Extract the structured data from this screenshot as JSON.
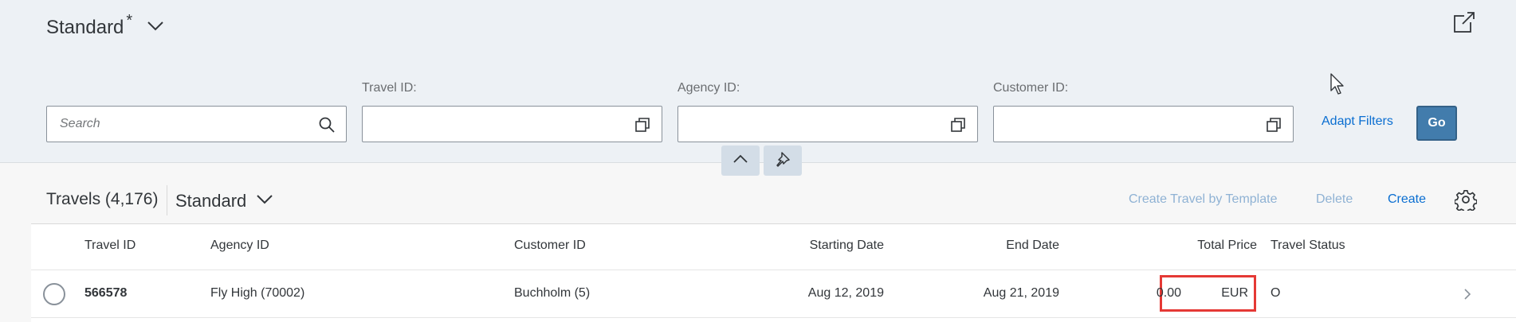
{
  "header": {
    "variant_title": "Standard",
    "variant_modified": "*"
  },
  "filters": {
    "search_placeholder": "Search",
    "travel_id_label": "Travel ID:",
    "agency_id_label": "Agency ID:",
    "customer_id_label": "Customer ID:",
    "adapt_filters_label": "Adapt Filters",
    "go_label": "Go"
  },
  "table": {
    "title": "Travels (4,176)",
    "variant": "Standard",
    "actions": {
      "create_by_template": "Create Travel by Template",
      "delete": "Delete",
      "create": "Create"
    },
    "columns": [
      "Travel ID",
      "Agency ID",
      "Customer ID",
      "Starting Date",
      "End Date",
      "Total Price",
      "Travel Status"
    ],
    "rows": [
      {
        "travel_id": "566578",
        "agency": "Fly High (70002)",
        "customer": "Buchholm (5)",
        "start": "Aug 12, 2019",
        "end": "Aug 21, 2019",
        "price": "0.00",
        "currency": "EUR",
        "status": "O"
      }
    ]
  },
  "colors": {
    "accent": "#0a6ed1",
    "go_button": "#427cac",
    "highlight": "#e53935",
    "disabled_action": "#8fb2d4"
  },
  "icons": [
    "chevron-down-icon",
    "share-icon",
    "search-icon",
    "value-help-icon",
    "collapse-header-icon",
    "pin-icon",
    "settings-icon",
    "navigation-arrow-icon",
    "mouse-cursor-icon"
  ]
}
